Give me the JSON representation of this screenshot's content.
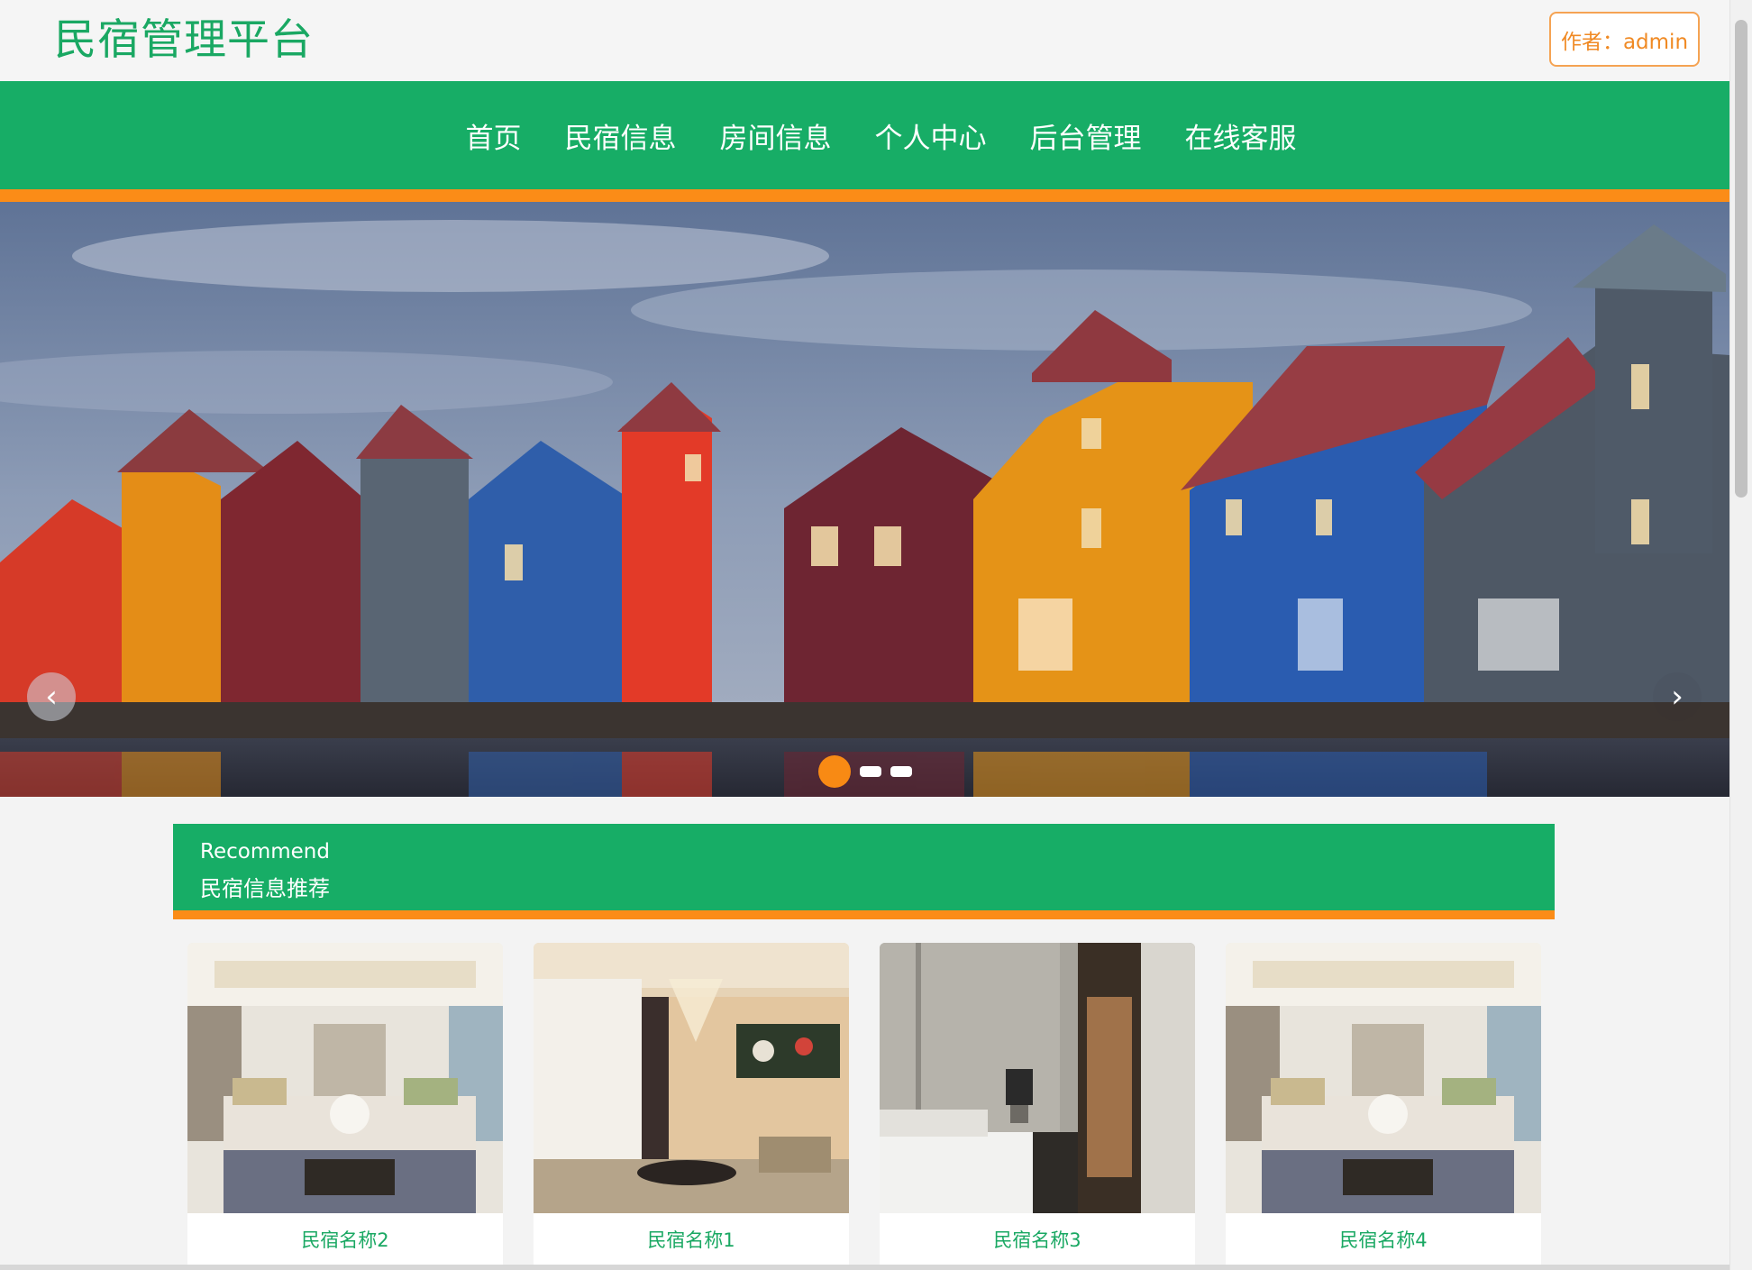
{
  "header": {
    "site_title": "民宿管理平台",
    "author_label": "作者：admin"
  },
  "nav": {
    "items": [
      {
        "label": "首页"
      },
      {
        "label": "民宿信息"
      },
      {
        "label": "房间信息"
      },
      {
        "label": "个人中心"
      },
      {
        "label": "后台管理"
      },
      {
        "label": "在线客服"
      }
    ]
  },
  "banner": {
    "image_desc": "colorful waterfront houses",
    "prev_icon": "chevron-left-icon",
    "next_icon": "chevron-right-icon",
    "slide_count": 3,
    "active_slide": 1
  },
  "recommend": {
    "title_en": "Recommend",
    "title_cn": "民宿信息推荐",
    "cards": [
      {
        "name": "民宿名称2"
      },
      {
        "name": "民宿名称1"
      },
      {
        "name": "民宿名称3"
      },
      {
        "name": "民宿名称4"
      }
    ]
  },
  "colors": {
    "brand_green": "#17ad66",
    "accent_orange": "#fb8c17",
    "background": "#f3f3f3"
  }
}
